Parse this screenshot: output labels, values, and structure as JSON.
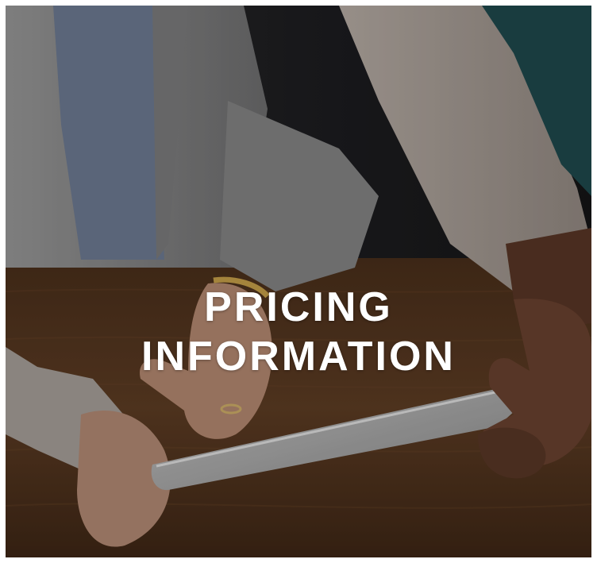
{
  "card": {
    "title_line1": "PRICING",
    "title_line2": "INFORMATION"
  },
  "colors": {
    "title_text": "#ffffff",
    "table_wood": "#5a3a22",
    "background_dark": "#1a1a1c"
  }
}
